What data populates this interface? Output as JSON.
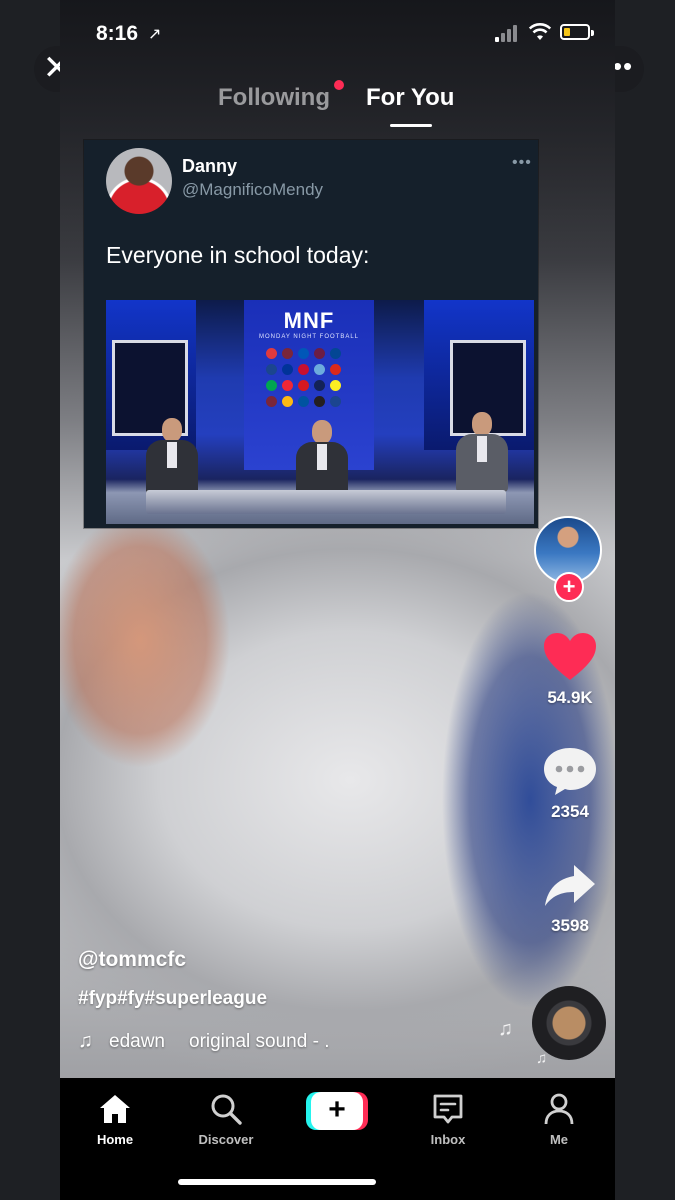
{
  "status_bar": {
    "time": "8:16"
  },
  "top_nav": {
    "following": "Following",
    "for_you": "For You"
  },
  "tweet": {
    "name": "Danny",
    "handle": "@MagnificoMendy",
    "text": "Everyone in school today:",
    "media": {
      "logo": "MNF",
      "subtitle": "MONDAY NIGHT FOOTBALL"
    }
  },
  "actions": {
    "likes": "54.9K",
    "comments": "2354",
    "shares": "3598"
  },
  "caption": {
    "username": "@tommcfc",
    "hashtags": "#fyp#fy#superleague",
    "music_artist": "edawn",
    "music_title": "original sound - ."
  },
  "bottom_nav": {
    "home": "Home",
    "discover": "Discover",
    "create": "+",
    "inbox": "Inbox",
    "me": "Me"
  },
  "colors": {
    "accent_red": "#fe2c55",
    "accent_cyan": "#25f4ee",
    "tweet_bg": "#15202b",
    "like_heart": "#fe2c55"
  },
  "icons": [
    "close-icon",
    "more-icon",
    "heart-icon",
    "comment-icon",
    "share-icon",
    "music-note-icon",
    "home-icon",
    "discover-icon",
    "inbox-icon",
    "me-icon"
  ]
}
